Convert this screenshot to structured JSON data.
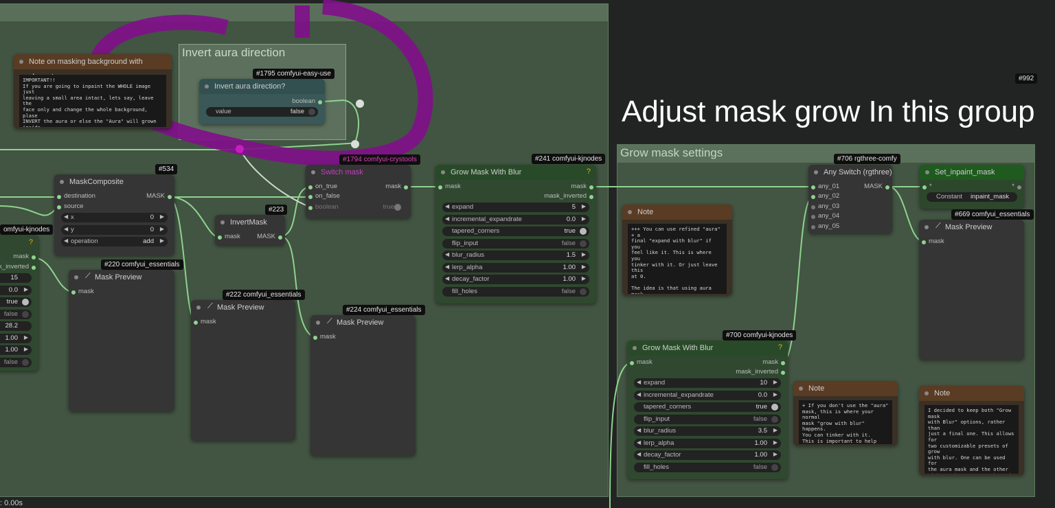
{
  "colors": {
    "wire": "#8fd48f",
    "aura": "#80108a",
    "canvas": "#222423",
    "group": "#425442"
  },
  "groups": {
    "aura_title": "Invert aura direction",
    "grow_title": "Grow mask settings",
    "big_title": "Adjust mask grow In this group"
  },
  "badges": {
    "b992": "#992",
    "b1795": "#1795 comfyui-easy-use",
    "b1794": "#1794 comfyui-crystools",
    "b241": "#241 comfyui-kjnodes",
    "b534": "#534",
    "b223": "#223",
    "b220": "#220 comfyui_essentials",
    "b222": "#222 comfyui_essentials",
    "b224": "#224 comfyui_essentials",
    "b706": "#706 rgthree-comfy",
    "b669": "#669 comfyui_essentials",
    "b700": "#700 comfyui-kjnodes",
    "bkj": "omfyui-kjnodes"
  },
  "note_masking": {
    "title": "Note on masking background with character",
    "text": "IMPORTANT!!\nIf you are going to inpaint the WHOLE image just\nleaving a small area intact, lets say, leave the\nface only and change the whole background, plase\nINVERT the aura or else the \"Aura\" will grown inside\nthe face. Use this toggle here  ++++++++++>"
  },
  "invert_aura": {
    "title": "Invert aura direction?",
    "output": "boolean",
    "widget": "value",
    "value": "false"
  },
  "switch_mask": {
    "title": "Switch mask",
    "in1": "on_true",
    "in2": "on_false",
    "out": "mask",
    "widget": "boolean",
    "value": "true"
  },
  "mask_composite": {
    "title": "MaskComposite",
    "in1": "destination",
    "in2": "source",
    "out": "MASK",
    "x": "x",
    "x_val": "0",
    "y": "y",
    "y_val": "0",
    "op": "operation",
    "op_val": "add"
  },
  "invert_mask": {
    "title": "InvertMask",
    "in": "mask",
    "out": "MASK"
  },
  "mask_preview": {
    "title": "Mask Preview",
    "in": "mask"
  },
  "left_partial": {
    "out1": "mask",
    "out2": "mask_inverted",
    "v1": "15",
    "v2": "0.0",
    "v3": "true",
    "v4": "false",
    "v5": "28.2",
    "v6": "1.00",
    "v7": "1.00",
    "v8": "false"
  },
  "grow1": {
    "title": "Grow Mask With Blur",
    "in": "mask",
    "out1": "mask",
    "out2": "mask_inverted",
    "expand": "expand",
    "expand_v": "5",
    "inc": "incremental_expandrate",
    "inc_v": "0.0",
    "taper": "tapered_corners",
    "taper_v": "true",
    "flip": "flip_input",
    "flip_v": "false",
    "blur": "blur_radius",
    "blur_v": "1.5",
    "lerp": "lerp_alpha",
    "lerp_v": "1.00",
    "decay": "decay_factor",
    "decay_v": "1.00",
    "fill": "fill_holes",
    "fill_v": "false"
  },
  "grow2": {
    "title": "Grow Mask With Blur",
    "in": "mask",
    "out1": "mask",
    "out2": "mask_inverted",
    "expand": "expand",
    "expand_v": "10",
    "inc": "incremental_expandrate",
    "inc_v": "0.0",
    "taper": "tapered_corners",
    "taper_v": "true",
    "flip": "flip_input",
    "flip_v": "false",
    "blur": "blur_radius",
    "blur_v": "3.5",
    "lerp": "lerp_alpha",
    "lerp_v": "1.00",
    "decay": "decay_factor",
    "decay_v": "1.00",
    "fill": "fill_holes",
    "fill_v": "false"
  },
  "note1": {
    "title": "Note",
    "text": "+++ You can use refined \"aura\" + a\nfinal \"expand with blur\" if you\nfeel like it. This is where you\ntinker with it. Or just leave this\nat 0.\n\nThe idea is that using aura mask\nyou would not need grow with blur\nas much."
  },
  "note2": {
    "title": "Note",
    "text": "+ If you don't use the \"aura\"\nmask, this is where your normal\nmask \"grow with blur\" happens.\nYou can tinker with it.\nThis is important to help with\nblending."
  },
  "note3": {
    "title": "Note",
    "text": "I decided to keep both \"Grow mask\nwith Blur\" options, rather than\njust a final one. This allows for\ntwo customizable presets of grow\nwith blur. One can be used for\nthe aura mask and the other\nwithout the aura, so there is no\nneed for extensive adjustments -\nsimply utilize the control room\ntoggle."
  },
  "any_switch": {
    "title": "Any Switch (rgthree)",
    "out": "MASK",
    "i1": "any_01",
    "i2": "any_02",
    "i3": "any_03",
    "i4": "any_04",
    "i5": "any_05"
  },
  "set_inpaint": {
    "title": "Set_inpaint_mask",
    "in": "*",
    "out": "*",
    "widget": "Constant",
    "value": "inpaint_mask"
  },
  "status": {
    "time": ": 0.00s"
  }
}
